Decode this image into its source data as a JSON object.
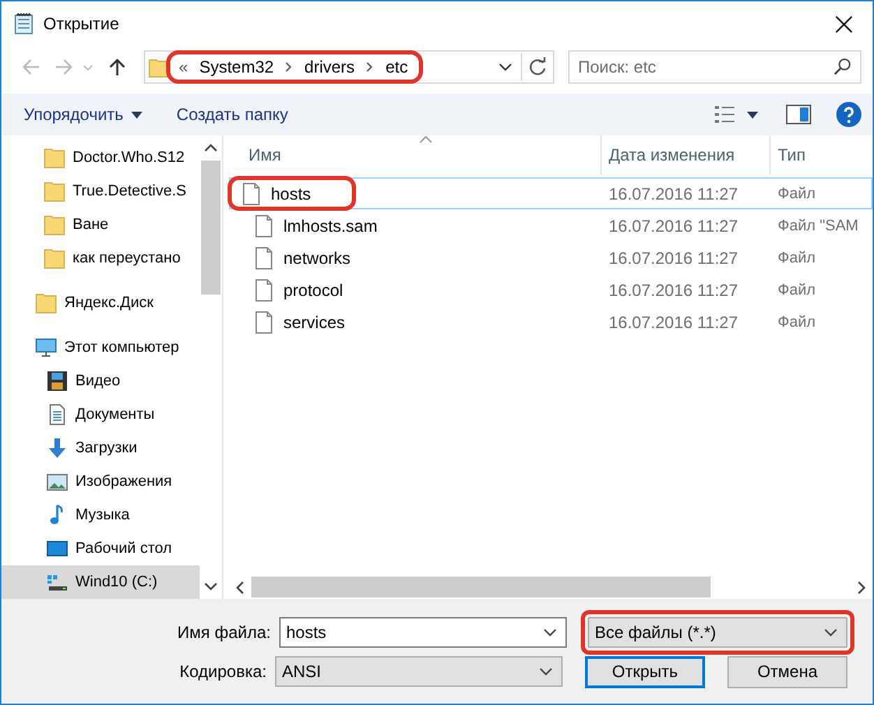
{
  "window": {
    "title": "Открытие"
  },
  "address": {
    "prefix": "«",
    "crumbs": [
      "System32",
      "drivers",
      "etc"
    ],
    "highlighted": true
  },
  "search": {
    "placeholder": "Поиск: etc"
  },
  "toolbar": {
    "organize": "Упорядочить",
    "new_folder": "Создать папку"
  },
  "sidebar": {
    "items": [
      {
        "kind": "group_tail",
        "children": [
          {
            "label": "Doctor.Who.S12",
            "kind": "folder",
            "selected": false
          },
          {
            "label": "True.Detective.S",
            "kind": "folder",
            "selected": false
          },
          {
            "label": "Ване",
            "kind": "folder",
            "selected": false
          },
          {
            "label": "как переустано",
            "kind": "folder",
            "selected": false
          }
        ]
      },
      {
        "label": "Яндекс.Диск",
        "kind": "folder",
        "selected": false
      },
      {
        "label": "Этот компьютер",
        "kind": "computer",
        "selected": false,
        "children": [
          {
            "label": "Видео",
            "kind": "video",
            "selected": false
          },
          {
            "label": "Документы",
            "kind": "documents",
            "selected": false
          },
          {
            "label": "Загрузки",
            "kind": "downloads",
            "selected": false
          },
          {
            "label": "Изображения",
            "kind": "pictures",
            "selected": false
          },
          {
            "label": "Музыка",
            "kind": "music",
            "selected": false
          },
          {
            "label": "Рабочий стол",
            "kind": "desktop",
            "selected": false
          },
          {
            "label": "Wind10 (C:)",
            "kind": "drive",
            "selected": true
          }
        ]
      }
    ]
  },
  "table": {
    "columns": [
      "Имя",
      "Дата изменения",
      "Тип"
    ],
    "rows": [
      {
        "name": "hosts",
        "date": "16.07.2016 11:27",
        "type": "Файл",
        "selected": true,
        "highlighted": true
      },
      {
        "name": "lmhosts.sam",
        "date": "16.07.2016 11:27",
        "type": "Файл \"SAM",
        "selected": false,
        "highlighted": false
      },
      {
        "name": "networks",
        "date": "16.07.2016 11:27",
        "type": "Файл",
        "selected": false,
        "highlighted": false
      },
      {
        "name": "protocol",
        "date": "16.07.2016 11:27",
        "type": "Файл",
        "selected": false,
        "highlighted": false
      },
      {
        "name": "services",
        "date": "16.07.2016 11:27",
        "type": "Файл",
        "selected": false,
        "highlighted": false
      }
    ]
  },
  "filename": {
    "label": "Имя файла:",
    "value": "hosts"
  },
  "filter": {
    "value": "Все файлы  (*.*)",
    "highlighted": true
  },
  "encoding": {
    "label": "Кодировка:",
    "value": "ANSI"
  },
  "buttons": [
    {
      "label": "Открыть",
      "kind": "default"
    },
    {
      "label": "Отмена",
      "kind": "normal"
    }
  ]
}
